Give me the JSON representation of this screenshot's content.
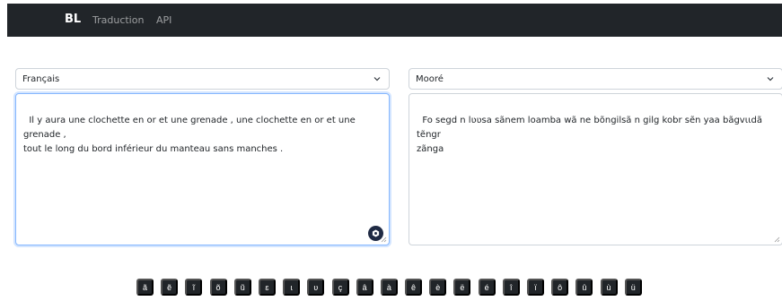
{
  "navbar": {
    "brand": "BL",
    "links": [
      "Traduction",
      "API"
    ]
  },
  "source": {
    "language": "Français",
    "text": "Il y aura une clochette en or et une grenade , une clochette en or et une grenade ,\ntout le long du bord inférieur du manteau sans manches ."
  },
  "target": {
    "language": "Mooré",
    "text": "Fo segd n lʋʋsa sãnem loamba wã ne bõngilsã n gilg kobr sẽn yaa bãgvɩɩdã tẽngr\nzãnga"
  },
  "special_chars": [
    "ã",
    "ẽ",
    "ĩ",
    "õ",
    "ũ",
    "ɛ",
    "ɩ",
    "ʋ",
    "ç",
    "â",
    "à",
    "ê",
    "è",
    "ë",
    "é",
    "î",
    "ï",
    "ô",
    "û",
    "ù",
    "ü"
  ],
  "icons": {
    "select_chevron": "chevron-down-icon",
    "action_button": "hexagon-icon",
    "resize_handle": "resize-grip-icon"
  },
  "colors": {
    "navbar_bg": "#212529",
    "key_bg": "#212529",
    "focus_border": "#86b7fe"
  }
}
